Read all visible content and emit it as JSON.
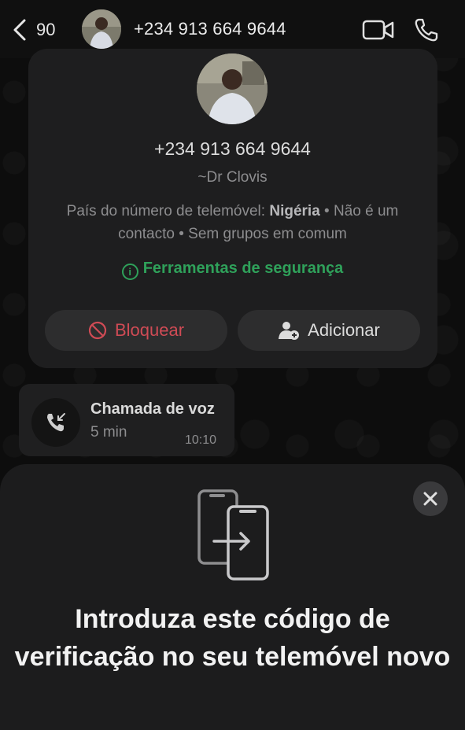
{
  "header": {
    "back_count": "90",
    "title": "+234 913 664 9644"
  },
  "contact_card": {
    "phone": "+234 913 664 9644",
    "name": "~Dr Clovis",
    "info_prefix": "País do número de telemóvel: ",
    "info_country": "Nigéria",
    "info_suffix": " • Não é um contacto • Sem grupos em comum",
    "security_label": "Ferramentas de segurança",
    "block_label": "Bloquear",
    "add_label": "Adicionar"
  },
  "call_message": {
    "title": "Chamada de voz",
    "duration": "5 min",
    "time": "10:10"
  },
  "sheet": {
    "title": "Introduza este código de verificação no seu telemóvel novo"
  },
  "colors": {
    "accent_green": "#2fa15a",
    "danger_red": "#d04b55",
    "background": "#0b0b0b",
    "card": "#1e1e1f"
  },
  "icons": [
    "chevron-left-icon",
    "video-call-icon",
    "phone-icon",
    "info-icon",
    "block-icon",
    "add-contact-icon",
    "incoming-call-icon",
    "close-icon",
    "transfer-phones-icon"
  ]
}
